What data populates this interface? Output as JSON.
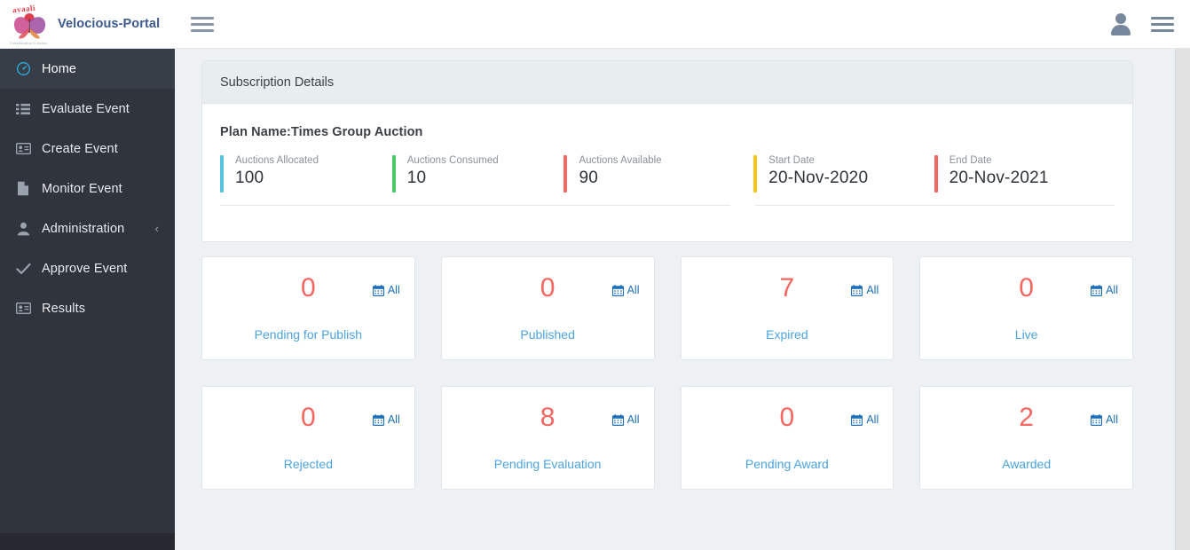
{
  "header": {
    "logo_text": "avaali",
    "logo_tagline": "Collaboration in Action",
    "brand": "Velocious-Portal",
    "menu_toggle_icon": "hamburger-icon",
    "user_icon": "user-icon",
    "right_menu_icon": "hamburger-icon"
  },
  "sidebar": {
    "items": [
      {
        "label": "Home",
        "icon": "dashboard-icon",
        "active": true,
        "chevron": ""
      },
      {
        "label": "Evaluate Event",
        "icon": "list-icon",
        "active": false,
        "chevron": ""
      },
      {
        "label": "Create Event",
        "icon": "id-card-icon",
        "active": false,
        "chevron": ""
      },
      {
        "label": "Monitor Event",
        "icon": "document-icon",
        "active": false,
        "chevron": ""
      },
      {
        "label": "Administration",
        "icon": "user-icon",
        "active": false,
        "chevron": "‹"
      },
      {
        "label": "Approve Event",
        "icon": "check-icon",
        "active": false,
        "chevron": ""
      },
      {
        "label": "Results",
        "icon": "id-card-icon",
        "active": false,
        "chevron": ""
      }
    ]
  },
  "subscription": {
    "panel_title": "Subscription Details",
    "plan_label": "Plan Name:",
    "plan_value": "Times Group Auction",
    "metrics_left": [
      {
        "label": "Auctions Allocated",
        "value": "100",
        "color": "#5bc0de"
      },
      {
        "label": "Auctions Consumed",
        "value": "10",
        "color": "#4cc76a"
      },
      {
        "label": "Auctions Available",
        "value": "90",
        "color": "#f4675f"
      }
    ],
    "metrics_right": [
      {
        "label": "Start Date",
        "value": "20-Nov-2020",
        "color": "#f5c518"
      },
      {
        "label": "End Date",
        "value": "20-Nov-2021",
        "color": "#f4675f"
      }
    ]
  },
  "stats": {
    "all_label": "All",
    "all_icon": "calendar-icon",
    "cards": [
      {
        "value": "0",
        "label": "Pending for Publish"
      },
      {
        "value": "0",
        "label": "Published"
      },
      {
        "value": "7",
        "label": "Expired"
      },
      {
        "value": "0",
        "label": "Live"
      },
      {
        "value": "0",
        "label": "Rejected"
      },
      {
        "value": "8",
        "label": "Pending Evaluation"
      },
      {
        "value": "0",
        "label": "Pending Award"
      },
      {
        "value": "2",
        "label": "Awarded"
      }
    ]
  },
  "theme": {
    "sidebar_bg": "#2f343d",
    "accent_blue": "#4ba3dd",
    "number_red": "#f4665f",
    "link_blue": "#1e6fb8",
    "page_bg": "#eef1f4"
  }
}
